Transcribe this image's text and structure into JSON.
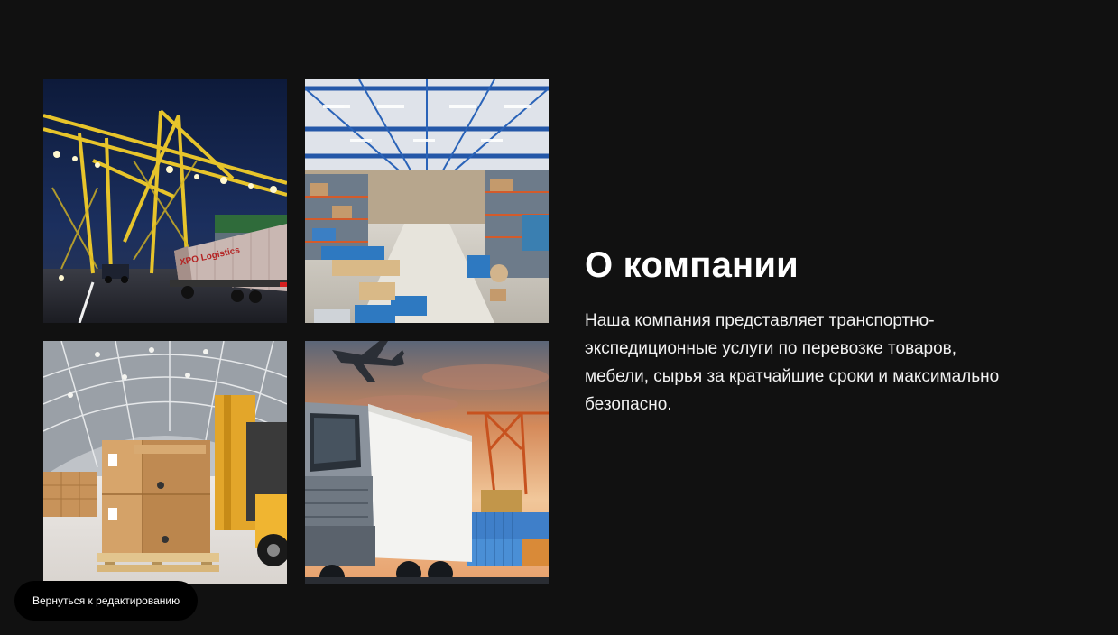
{
  "about": {
    "heading": "О компании",
    "body": "Наша компания представляет транспортно-экспедиционные услуги по перевозке товаров, мебели, сырья за кратчайшие сроки и максимально безопасно."
  },
  "gallery": {
    "images": [
      {
        "name": "port-cranes-truck-photo",
        "truck_logo": "XPO Logistics"
      },
      {
        "name": "warehouse-interior-photo"
      },
      {
        "name": "cardboard-boxes-forklift-photo"
      },
      {
        "name": "truck-airplane-containers-photo"
      }
    ]
  },
  "editor": {
    "back_button_label": "Вернуться к редактированию"
  },
  "colors": {
    "background": "#111111",
    "text": "#ffffff",
    "button_bg": "#000000"
  }
}
